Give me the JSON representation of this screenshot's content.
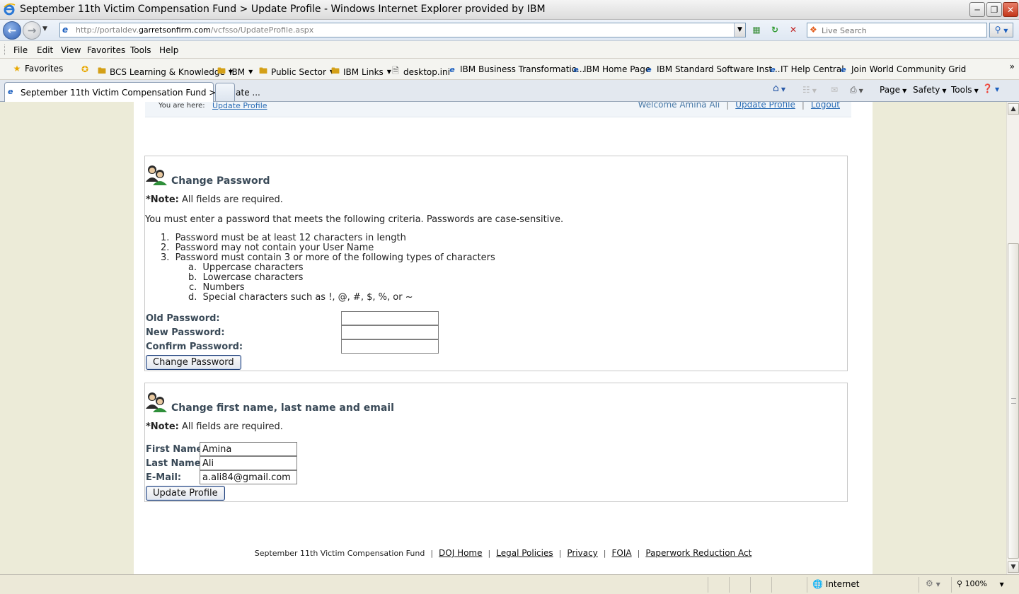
{
  "window": {
    "title": "September 11th Victim Compensation Fund > Update Profile - Windows Internet Explorer provided by IBM"
  },
  "address": {
    "url_prefix": "http://portaldev.",
    "url_domain": "garretsonfirm.com",
    "url_path": "/vcfsso/UpdateProfile.aspx",
    "search_placeholder": "Live Search"
  },
  "menu": [
    "File",
    "Edit",
    "View",
    "Favorites",
    "Tools",
    "Help"
  ],
  "favorites": {
    "label": "Favorites",
    "items": [
      {
        "label": "BCS Learning & Knowledge",
        "icon": "folder-icon",
        "dropdown": true
      },
      {
        "label": "IBM",
        "icon": "folder-icon",
        "dropdown": true
      },
      {
        "label": "Public Sector",
        "icon": "folder-icon",
        "dropdown": true
      },
      {
        "label": "IBM Links",
        "icon": "folder-icon",
        "dropdown": true
      },
      {
        "label": "desktop.ini",
        "icon": "file-icon",
        "dropdown": false
      },
      {
        "label": "IBM Business Transformatio...",
        "icon": "page-icon",
        "dropdown": false
      },
      {
        "label": "IBM Home Page",
        "icon": "page-icon",
        "dropdown": false
      },
      {
        "label": "IBM Standard Software Inst...",
        "icon": "page-icon",
        "dropdown": false
      },
      {
        "label": "IT Help Central",
        "icon": "page-icon",
        "dropdown": false
      },
      {
        "label": "Join World Community Grid",
        "icon": "page-icon",
        "dropdown": false
      }
    ]
  },
  "tab": {
    "label": "September 11th Victim Compensation Fund > Update ..."
  },
  "commands": {
    "page": "Page",
    "safety": "Safety",
    "tools": "Tools"
  },
  "breadcrumb": {
    "you_are_here": "You are here:",
    "current": "Update Profile",
    "welcome": "Welcome Amina Ali",
    "update_profile": "Update Profile",
    "logout": "Logout"
  },
  "change_password": {
    "heading": "Change Password",
    "note_label": "*Note:",
    "note_text": " All fields are required.",
    "intro": "You must enter a password that meets the following criteria. Passwords are case-sensitive.",
    "criteria": [
      {
        "num": "1.",
        "text": "Password must be at least 12 characters in length"
      },
      {
        "num": "2.",
        "text": "Password may not contain your User Name"
      },
      {
        "num": "3.",
        "text": "Password must contain 3 or more of the following types of characters"
      }
    ],
    "subcriteria": [
      {
        "num": "a.",
        "text": "Uppercase characters"
      },
      {
        "num": "b.",
        "text": "Lowercase characters"
      },
      {
        "num": "c.",
        "text": "Numbers"
      },
      {
        "num": "d.",
        "text": "Special characters such as !, @, #, $, %, or ~"
      }
    ],
    "old_label": "Old Password:",
    "new_label": "New Password:",
    "confirm_label": "Confirm Password:",
    "old_value": "",
    "new_value": "",
    "confirm_value": "",
    "button": "Change Password"
  },
  "profile": {
    "heading": "Change first name, last name and email",
    "note_label": "*Note:",
    "note_text": " All fields are required.",
    "first_label": "First Name:",
    "last_label": "Last Name:",
    "email_label": "E-Mail:",
    "first_value": "Amina",
    "last_value": "Ali",
    "email_value": "a.ali84@gmail.com",
    "button": "Update Profile"
  },
  "footer": {
    "org": "September 11th Victim Compensation Fund",
    "links": [
      "DOJ Home",
      "Legal Policies",
      "Privacy",
      "FOIA",
      "Paperwork Reduction Act"
    ]
  },
  "status": {
    "zone": "Internet",
    "zoom": "100%"
  }
}
